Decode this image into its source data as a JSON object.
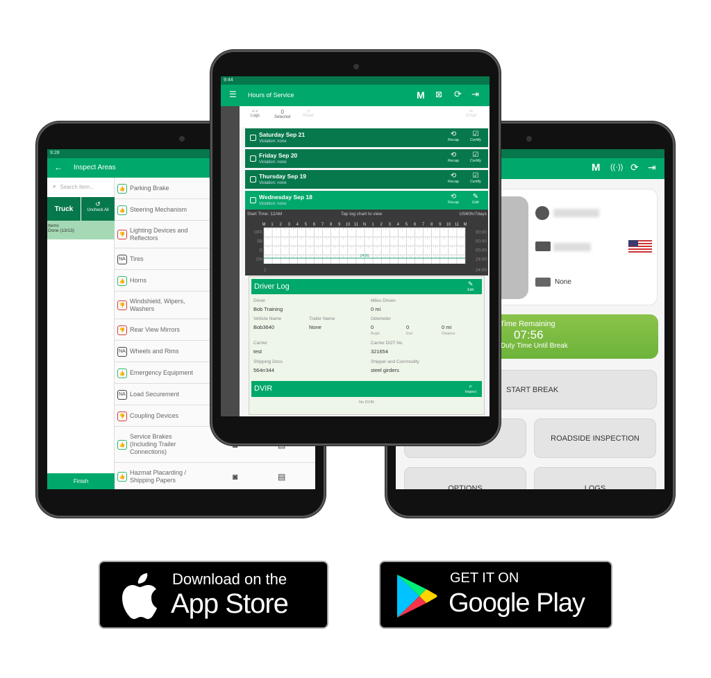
{
  "colors": {
    "primary": "#00a86b",
    "dark": "#07784c",
    "pass": "#2eb872",
    "fail": "#d23b3b",
    "warning": "#f5b800",
    "time_remaining": "#7cbf3f"
  },
  "left": {
    "time": "9:28",
    "title": "Inspect Areas",
    "back_icon": "arrow-left-icon",
    "search_placeholder": "Search item...",
    "truck": "Truck",
    "uncheck_all": "Uncheck All",
    "items_label": "Items",
    "items_done": "Done (13/13)",
    "finish": "Finish",
    "items": [
      {
        "label": "Parking Brake",
        "status": "pass"
      },
      {
        "label": "Steering Mechanism",
        "status": "pass"
      },
      {
        "label": "Lighting Devices and Reflectors",
        "status": "fail",
        "warning": true
      },
      {
        "label": "Tires",
        "status": "na"
      },
      {
        "label": "Horns",
        "status": "pass"
      },
      {
        "label": "Windshield, Wipers, Washers",
        "status": "fail",
        "warning": true
      },
      {
        "label": "Rear View Mirrors",
        "status": "fail",
        "warning": true
      },
      {
        "label": "Wheels and Rims",
        "status": "na"
      },
      {
        "label": "Emergency Equipment",
        "status": "pass"
      },
      {
        "label": "Load Securement",
        "status": "na"
      },
      {
        "label": "Coupling Devices",
        "status": "fail",
        "warning": true
      },
      {
        "label": "Service Brakes (Including Trailer Connections)",
        "status": "pass",
        "actions": true
      },
      {
        "label": "Hazmat Placarding / Shipping Papers",
        "status": "pass",
        "actions": true
      }
    ]
  },
  "center": {
    "time": "9:44",
    "title": "Hours of Service",
    "m": "M",
    "toolbar": {
      "logs": "Logs",
      "selected_count": "0",
      "selected": "Selected",
      "reset": "Reset",
      "email": "Email"
    },
    "days": [
      {
        "title": "Saturday Sep 21",
        "violation": "Violation: none",
        "a1": "Recap",
        "a2": "Certify"
      },
      {
        "title": "Friday Sep 20",
        "violation": "Violation: none",
        "a1": "Recap",
        "a2": "Certify"
      },
      {
        "title": "Thursday Sep 19",
        "violation": "Violation: none",
        "a1": "Recap",
        "a2": "Certify"
      },
      {
        "title": "Wednesday Sep 18",
        "violation": "Violation: none",
        "a1": "Recap",
        "a2": "Edit"
      }
    ],
    "chart": {
      "start": "Start Time: 12AM",
      "tap": "Tap log chart to view",
      "ruleset": "US60hr7days",
      "hours": [
        "M",
        "1",
        "2",
        "3",
        "4",
        "5",
        "6",
        "7",
        "8",
        "9",
        "10",
        "11",
        "N",
        "1",
        "2",
        "3",
        "4",
        "5",
        "6",
        "7",
        "8",
        "9",
        "10",
        "11",
        "M"
      ],
      "rows": [
        "OFF",
        "SB",
        "D",
        "ON"
      ],
      "totals": [
        "00:00",
        "00:00",
        "00:00",
        "24:00"
      ],
      "grand_total": "24:00",
      "on_label": "24:00",
      "bottom_left": "2"
    },
    "driver_log": {
      "title": "Driver Log",
      "edit": "Edit",
      "driver_label": "Driver",
      "driver": "Bob Training",
      "miles_label": "Miles Driven",
      "miles": "0 mi",
      "vehicle_label": "Vehicle Name",
      "vehicle": "Bob3640",
      "trailer_label": "Trailer Name",
      "trailer": "None",
      "odometer_label": "Odometer",
      "begin": "0",
      "begin_label": "Begin",
      "end": "0",
      "end_label": "End",
      "distance": "0 mi",
      "distance_label": "Distance",
      "carrier_label": "Carrier",
      "carrier": "test",
      "dot_label": "Carrier DOT No",
      "dot": "321654",
      "docs_label": "Shipping Docs",
      "docs": "564rr344",
      "shipper_label": "Shipper and Commodity",
      "shipper": "steel girders"
    },
    "dvir": {
      "title": "DVIR",
      "inspect": "Inspect",
      "empty": "No DVIR"
    }
  },
  "right": {
    "m": "M",
    "trailer": "None",
    "time_title": "Time Remaining",
    "time": "07:56",
    "time_sub": "Duty Time Until Break",
    "buttons": {
      "start_break": "START BREAK",
      "roadside": "ROADSIDE INSPECTION",
      "options": "OPTIONS",
      "logs": "LOGS"
    }
  },
  "stores": {
    "apple_top": "Download on the",
    "apple_bottom": "App Store",
    "google_top": "GET IT ON",
    "google_bottom": "Google Play"
  }
}
